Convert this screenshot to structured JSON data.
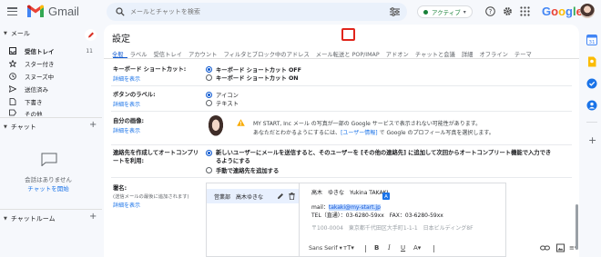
{
  "topbar": {
    "app_name": "Gmail",
    "search_placeholder": "メールとチャットを検索",
    "status_label": "アクティブ",
    "google_letters": [
      "G",
      "o",
      "o",
      "g",
      "l",
      "e"
    ],
    "google_colors": [
      "#4285f4",
      "#ea4335",
      "#fbbc05",
      "#4285f4",
      "#34a853",
      "#ea4335"
    ]
  },
  "sidebar": {
    "mail_header": "メール",
    "items": [
      {
        "label": "受信トレイ",
        "count": "11",
        "icon": "inbox-icon"
      },
      {
        "label": "スター付き",
        "count": "",
        "icon": "star-icon"
      },
      {
        "label": "スヌーズ中",
        "count": "",
        "icon": "clock-icon"
      },
      {
        "label": "送信済み",
        "count": "",
        "icon": "send-icon"
      },
      {
        "label": "下書き",
        "count": "",
        "icon": "draft-icon"
      },
      {
        "label": "その他",
        "count": "",
        "icon": "label-icon"
      }
    ],
    "chat_header": "チャット",
    "chat_empty": "会話はありません",
    "chat_start": "チャットを開始",
    "rooms_header": "チャットルーム"
  },
  "settings": {
    "title": "設定",
    "tabs": [
      "全般",
      "ラベル",
      "受信トレイ",
      "アカウント",
      "フィルタとブロック中のアドレス",
      "メール転送と POP/IMAP",
      "アドオン",
      "チャットと会議",
      "詳細",
      "オフライン",
      "テーマ"
    ],
    "rows": {
      "shortcuts": {
        "label": "キーボード ショートカット:",
        "link": "詳細を表示",
        "opt1": "キーボード ショートカット OFF",
        "opt2": "キーボード ショートカット ON"
      },
      "button_labels": {
        "label": "ボタンのラベル:",
        "link": "詳細を表示",
        "opt1": "アイコン",
        "opt2": "テキスト"
      },
      "my_picture": {
        "label": "自分の画像:",
        "link": "詳細を表示",
        "warning1": "MY START, Inc メール の写真が一部の Google サービスで表示されない可能性があります。",
        "warning2_pre": "あなただとわかるようにするには、",
        "warning2_link": "[ユーザー情報]",
        "warning2_post": " で Google のプロフィール写真を選択します。"
      },
      "autocomplete": {
        "label1": "連絡先を作成してオートコンプリ",
        "label2": "ートを利用:",
        "opt1": "新しいユーザーにメールを送信すると、そのユーザーを [その他の連絡先] に追加して次回からオートコンプリート機能で入力でき",
        "opt1b": "るようにする",
        "opt2": "手動で連絡先を追加する"
      },
      "signature": {
        "label": "署名:",
        "sub": "(送信メールの最後に追加されます)",
        "link": "詳細を表示",
        "item_name": "営業部　高木ゆきな",
        "lines": {
          "l1": "高木　ゆきな　Yukina TAKAKI",
          "l2_pre": "mail：",
          "l2_email": "takaki@my-start.jp",
          "l3": "TEL（直通）：03-6280-59xx　FAX：03-6280-59xx",
          "l4": "〒100-0004　東京都千代田区大手町1-1-1　日本ビルディング8F"
        },
        "toolbar_font": "Sans Serif"
      }
    }
  },
  "colors": {
    "accent": "#0b57d0",
    "link": "#1a73e8",
    "highlight_box": "#e0251b"
  }
}
